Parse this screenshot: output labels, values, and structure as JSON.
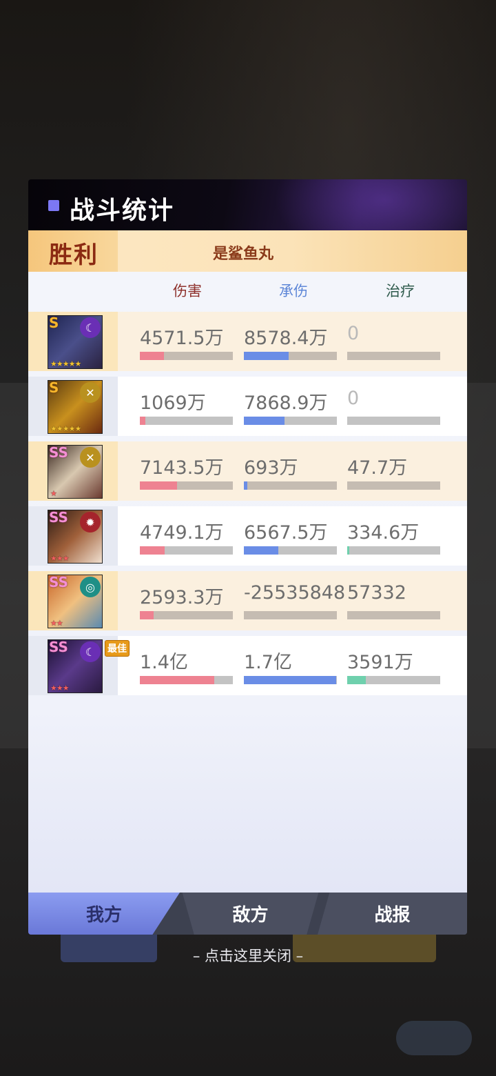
{
  "panel": {
    "title": "战斗统计",
    "result": "胜利",
    "player_name": "是鲨鱼丸"
  },
  "columns": {
    "damage": "伤害",
    "taken": "承伤",
    "heal": "治疗"
  },
  "rows": [
    {
      "rank": "S",
      "stars": "★★★★★",
      "damage": "4571.5万",
      "taken": "8578.4万",
      "heal": "0",
      "damage_pct": 0.26,
      "taken_pct": 0.48,
      "heal_pct": 0,
      "element_icon": "moon-icon"
    },
    {
      "rank": "S",
      "stars": "★★★★★",
      "damage": "1069万",
      "taken": "7868.9万",
      "heal": "0",
      "damage_pct": 0.06,
      "taken_pct": 0.44,
      "heal_pct": 0,
      "element_icon": "cross-icon"
    },
    {
      "rank": "SS",
      "stars": "★",
      "damage": "7143.5万",
      "taken": "693万",
      "heal": "47.7万",
      "damage_pct": 0.4,
      "taken_pct": 0.04,
      "heal_pct": 0.0,
      "element_icon": "cross-icon"
    },
    {
      "rank": "SS",
      "stars": "★★★",
      "damage": "4749.1万",
      "taken": "6567.5万",
      "heal": "334.6万",
      "damage_pct": 0.27,
      "taken_pct": 0.37,
      "heal_pct": 0.02,
      "element_icon": "flame-icon"
    },
    {
      "rank": "SS",
      "stars": "★★",
      "damage": "2593.3万",
      "taken": "-25535848",
      "heal": "57332",
      "damage_pct": 0.15,
      "taken_pct": 0,
      "heal_pct": 0,
      "element_icon": "wind-icon"
    },
    {
      "rank": "SS",
      "stars": "★★★",
      "damage": "1.4亿",
      "taken": "1.7亿",
      "heal": "3591万",
      "damage_pct": 0.8,
      "taken_pct": 0.99,
      "heal_pct": 0.2,
      "element_icon": "moon-icon",
      "best": "最佳"
    }
  ],
  "tabs": {
    "mine": "我方",
    "enemy": "敌方",
    "report": "战报"
  },
  "close_hint": "– 点击这里关闭 –",
  "colors": {
    "damage_bar": "#ee8291",
    "taken_bar": "#6a8de6",
    "heal_bar": "#6fd0ad",
    "title_bullet": "#7c78f4"
  }
}
